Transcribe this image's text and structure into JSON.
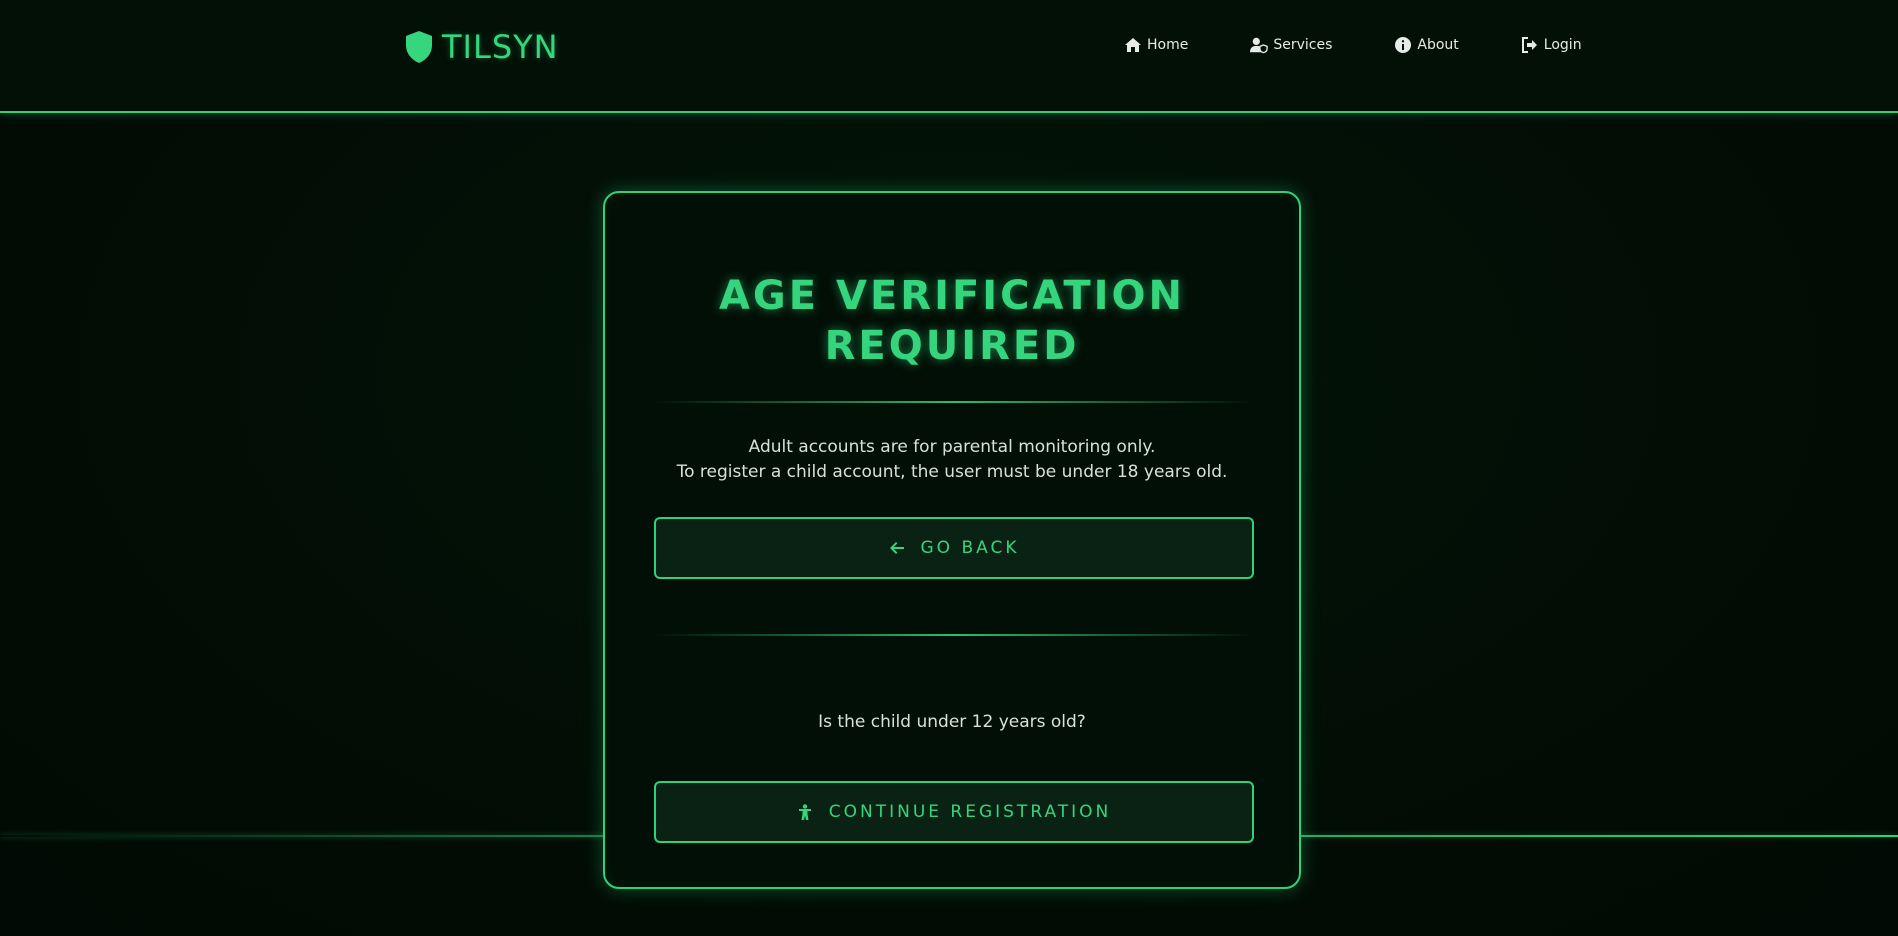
{
  "brand": {
    "name": "TILSYN",
    "logo_icon": "shield-icon"
  },
  "nav": [
    {
      "label": "Home",
      "icon": "home-icon"
    },
    {
      "label": "Services",
      "icon": "user-shield-icon"
    },
    {
      "label": "About",
      "icon": "info-icon"
    },
    {
      "label": "Login",
      "icon": "login-icon"
    }
  ],
  "card": {
    "title_line1": "AGE VERIFICATION",
    "title_line2": "REQUIRED",
    "desc_line1": "Adult accounts are for parental monitoring only.",
    "desc_line2": "To register a child account, the user must be under 18 years old.",
    "back_button": {
      "label": "GO BACK",
      "icon": "arrow-left-icon"
    },
    "question": "Is the child under 12 years old?",
    "continue_button": {
      "label": "CONTINUE REGISTRATION",
      "icon": "child-icon"
    }
  },
  "colors": {
    "accent": "#2fd27a",
    "background": "#020d05",
    "text": "#d8e0db"
  }
}
